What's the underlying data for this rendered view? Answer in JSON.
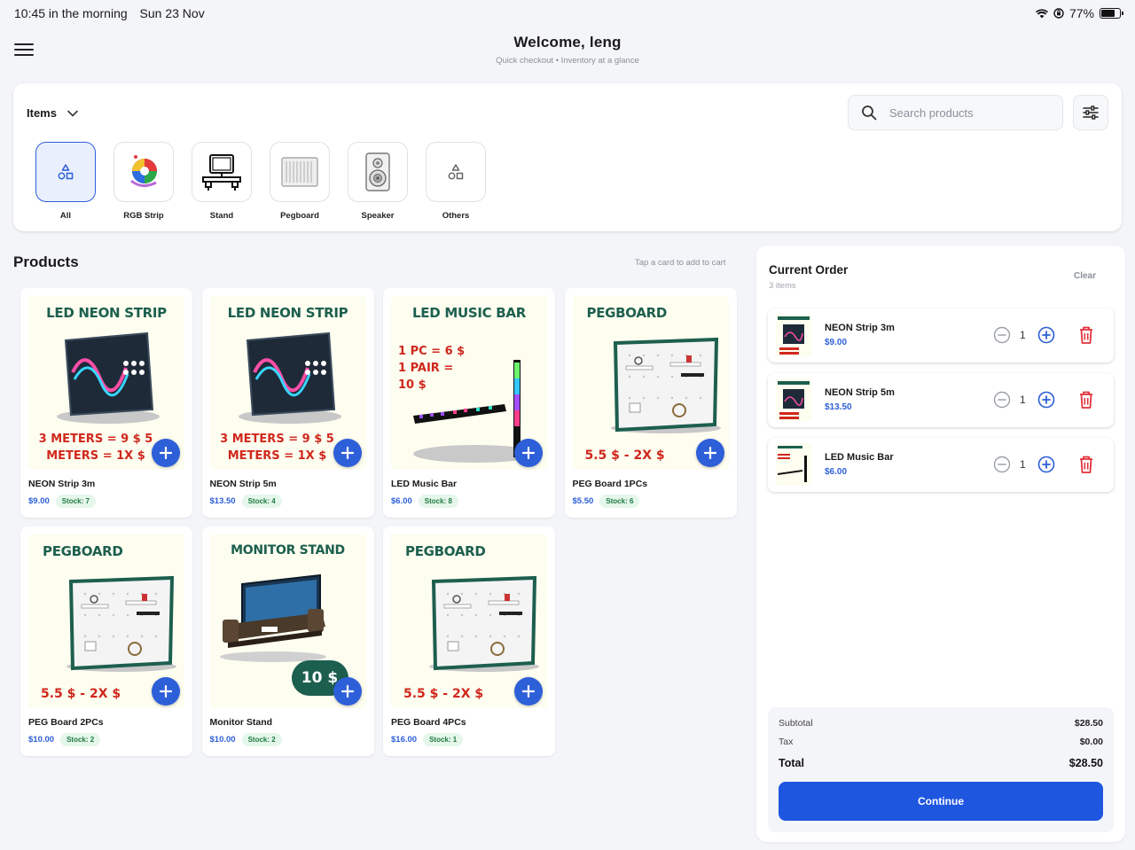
{
  "status_bar": {
    "time": "10:45 in the morning",
    "date": "Sun 23 Nov",
    "battery": "77%",
    "battery_level": 0.77
  },
  "header": {
    "title": "Welcome, leng",
    "subtitle": "Quick checkout • Inventory at a glance"
  },
  "filter": {
    "dropdown_label": "Items",
    "search_placeholder": "Search products"
  },
  "categories": [
    {
      "label": "All",
      "icon": "shapes-icon",
      "active": true
    },
    {
      "label": "RGB Strip",
      "icon": "rgb-strip-icon"
    },
    {
      "label": "Stand",
      "icon": "monitor-stand-icon"
    },
    {
      "label": "Pegboard",
      "icon": "pegboard-icon"
    },
    {
      "label": "Speaker",
      "icon": "speaker-icon"
    },
    {
      "label": "Others",
      "icon": "shapes-icon"
    }
  ],
  "products_section": {
    "title": "Products",
    "hint": "Tap a card to add to cart"
  },
  "products": [
    {
      "name": "NEON Strip 3m",
      "price": "$9.00",
      "stock": "Stock: 7",
      "img_title": "LED NEON STRIP",
      "img_text": "3 METERS = 9 $ 5 METERS = 1X $"
    },
    {
      "name": "NEON Strip 5m",
      "price": "$13.50",
      "stock": "Stock: 4",
      "img_title": "LED NEON STRIP",
      "img_text": "3 METERS = 9 $ 5 METERS = 1X $"
    },
    {
      "name": "LED Music Bar",
      "price": "$6.00",
      "stock": "Stock: 8",
      "img_title": "LED MUSIC BAR",
      "img_text": "1 PC = 6 $ 1 PAIR = 10 $"
    },
    {
      "name": "PEG Board 1PCs",
      "price": "$5.50",
      "stock": "Stock: 6",
      "img_title": "PEGBOARD",
      "img_text": "5.5 $ - 2X $"
    },
    {
      "name": "PEG Board 2PCs",
      "price": "$10.00",
      "stock": "Stock: 2",
      "img_title": "PEGBOARD",
      "img_text": "5.5 $ - 2X $"
    },
    {
      "name": "Monitor Stand",
      "price": "$10.00",
      "stock": "Stock: 2",
      "img_title": "MONITOR STAND",
      "img_text": "10 $"
    },
    {
      "name": "PEG Board 4PCs",
      "price": "$16.00",
      "stock": "Stock: 1",
      "img_title": "PEGBOARD",
      "img_text": "5.5 $ - 2X $"
    }
  ],
  "order": {
    "title": "Current Order",
    "count": "3 items",
    "clear_label": "Clear",
    "lines": [
      {
        "name": "NEON Strip 3m",
        "price": "$9.00",
        "qty": "1"
      },
      {
        "name": "NEON Strip 5m",
        "price": "$13.50",
        "qty": "1"
      },
      {
        "name": "LED Music Bar",
        "price": "$6.00",
        "qty": "1"
      }
    ],
    "subtotal_label": "Subtotal",
    "subtotal": "$28.50",
    "tax_label": "Tax",
    "tax": "$0.00",
    "total_label": "Total",
    "total": "$28.50",
    "continue_label": "Continue"
  },
  "colors": {
    "accent": "#2d5fd8",
    "button_primary": "#1f56e0",
    "danger": "#e0323a",
    "stock_badge": "#1f7a43",
    "packaging_green": "#1d5f4e",
    "packaging_red": "#d0281c"
  }
}
